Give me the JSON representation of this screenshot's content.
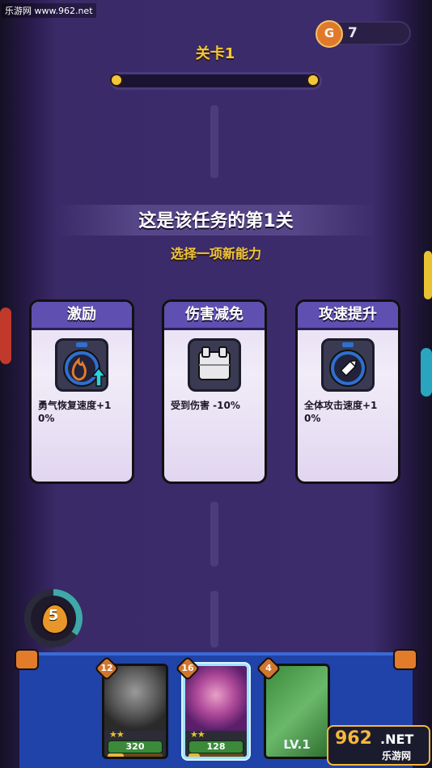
{
  "watermark": "乐游网 www.962.net",
  "currency": {
    "icon": "G",
    "value": "7",
    "icon_name": "gold-coin-icon"
  },
  "level": {
    "title": "关卡1",
    "progress": 0.0
  },
  "prompt": {
    "title": "这是该任务的第1关",
    "subtitle": "选择一项新能力"
  },
  "abilities": [
    {
      "name": "激励",
      "icon": "flame-up-icon",
      "desc": "勇气恢复速度+10%"
    },
    {
      "name": "伤害减免",
      "icon": "armor-vest-icon",
      "desc": "受到伤害 -10%"
    },
    {
      "name": "攻速提升",
      "icon": "bullet-icon",
      "desc": "全体攻击速度+10%"
    }
  ],
  "courage": {
    "value": "5",
    "fill": 0.35
  },
  "units": [
    {
      "cost": "12",
      "stars": "★★",
      "hp": "320",
      "xp": 0.3,
      "selected": false
    },
    {
      "cost": "16",
      "stars": "★★",
      "hp": "128",
      "xp": 0.2,
      "selected": true
    },
    {
      "cost": "4",
      "level": "LV.1",
      "selected": false
    }
  ],
  "logo": {
    "num": "962",
    "suffix": ".NET",
    "site": "乐游网"
  },
  "colors": {
    "accent": "#f2c63a",
    "card_header": "#5e4fb1",
    "panel": "#1f43a8"
  }
}
